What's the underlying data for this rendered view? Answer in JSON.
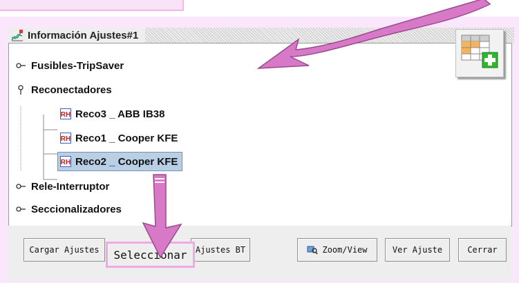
{
  "window": {
    "title": "Información Ajustes#1",
    "title_icon": "chart-settings-icon"
  },
  "tree": {
    "items": [
      {
        "label": "Fusibles-TripSaver",
        "icon": "collapsed-handle-icon"
      },
      {
        "label": "Reconectadores",
        "icon": "expanded-handle-icon"
      },
      {
        "label": "Reco3 _ ABB  IB38",
        "icon": "rh-device-icon"
      },
      {
        "label": "Reco1 _ Cooper  KFE",
        "icon": "rh-device-icon"
      },
      {
        "label": "Reco2 _ Cooper  KFE",
        "icon": "rh-device-icon",
        "selected": true
      },
      {
        "label": "Rele-Interruptor",
        "icon": "collapsed-handle-icon"
      },
      {
        "label": "Seccionalizadores",
        "icon": "collapsed-handle-icon"
      }
    ]
  },
  "buttons": {
    "cargar": "Cargar Ajustes",
    "seleccionar": "Seleccionar",
    "ajustes_bt": "Ajustes BT",
    "zoom_view": "Zoom/View",
    "ver_ajuste": "Ver Ajuste",
    "cerrar": "Cerrar"
  },
  "icons": {
    "zoom": "magnifier-icon",
    "add_table": "add-table-icon"
  },
  "colors": {
    "highlight": "#f0a8e6",
    "selection": "#b8cfe5",
    "add_plus": "#2fb52f"
  }
}
